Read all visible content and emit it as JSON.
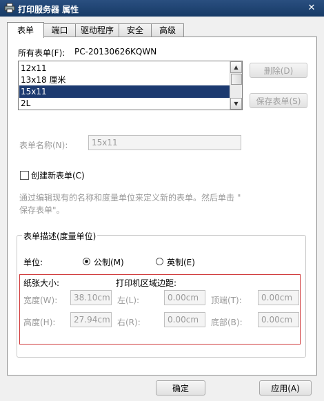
{
  "window": {
    "title": "打印服务器 属性",
    "close_glyph": "✕"
  },
  "tabs": [
    {
      "label": "表单"
    },
    {
      "label": "端口"
    },
    {
      "label": "驱动程序"
    },
    {
      "label": "安全"
    },
    {
      "label": "高级"
    }
  ],
  "forms": {
    "label": "所有表单(F):",
    "server": "PC-20130626KQWN",
    "items": [
      "12x11",
      "13x18 厘米",
      "15x11",
      "2L"
    ],
    "selected": "15x11",
    "delete_button": "删除(D)",
    "save_button": "保存表单(S)"
  },
  "form_name": {
    "label": "表单名称(N):",
    "value": "15x11"
  },
  "create_new": {
    "label": "创建新表单(C)",
    "checked": false
  },
  "hint": {
    "line1": "通过编辑现有的名称和度量单位来定义新的表单。然后单击 \"",
    "line2": "保存表单\"。"
  },
  "description": {
    "group_label": "表单描述(度量单位)",
    "unit_label": "单位:",
    "metric": "公制(M)",
    "imperial": "英制(E)",
    "selected_unit": "metric"
  },
  "paper_size": {
    "label": "纸张大小:",
    "width_label": "宽度(W):",
    "width_value": "38.10cm",
    "height_label": "高度(H):",
    "height_value": "27.94cm"
  },
  "margins": {
    "label": "打印机区域边距:",
    "left_label": "左(L):",
    "left_value": "0.00cm",
    "right_label": "右(R):",
    "right_value": "0.00cm",
    "top_label": "顶端(T):",
    "top_value": "0.00cm",
    "bottom_label": "底部(B):",
    "bottom_value": "0.00cm"
  },
  "footer": {
    "ok": "确定",
    "apply": "应用(A)"
  }
}
